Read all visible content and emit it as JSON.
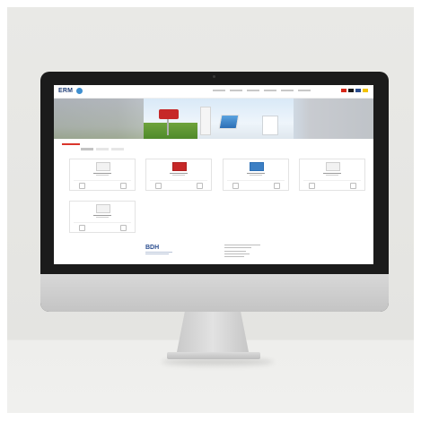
{
  "screen": {
    "logo_text": "ERM",
    "footer_logo_text": "BDH",
    "nav_items": [
      "",
      "",
      "",
      "",
      "",
      "",
      "",
      ""
    ],
    "flags": [
      "#d62718",
      "#1a1a1a",
      "#2a4d8f",
      "#f2c200"
    ],
    "cards": [
      {
        "image": "white-unit"
      },
      {
        "image": "red-unit"
      },
      {
        "image": "tablet"
      },
      {
        "image": "white-unit"
      },
      {
        "image": "white-unit"
      }
    ]
  },
  "colors": {
    "background": "#e4e4e1",
    "bezel": "#1b1b1b",
    "brand_blue": "#1f3e78",
    "accent_red": "#d9362b"
  }
}
